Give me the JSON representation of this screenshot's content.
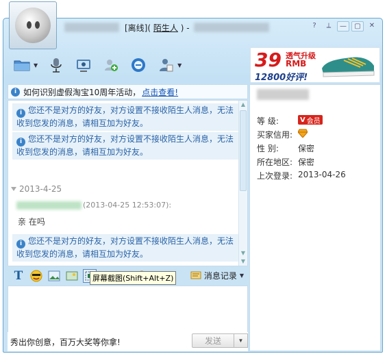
{
  "window": {
    "status": "[离线]",
    "title_prefix": "(",
    "stranger": "陌生人",
    "title_suffix": ") -"
  },
  "controls": [
    "?",
    "⟂",
    "—",
    "▢",
    "✕"
  ],
  "toolbar": {
    "icons": [
      "folder-icon",
      "microphone-icon",
      "camera-icon",
      "add-friend-icon",
      "browser-icon",
      "user-card-icon"
    ]
  },
  "ad": {
    "big_number": "39",
    "top_text": "透气升级",
    "rmb": "RMB",
    "bottom_text": "12800好评!"
  },
  "notice": {
    "text": "如何识别虚假淘宝10周年活动，",
    "link": "点击查看!"
  },
  "chat": {
    "system_msg": "您还不是对方的好友，对方设置不接收陌生人消息，无法收到您发的消息，请相互加为好友。",
    "date": "2013-4-25",
    "timestamp": "(2013-04-25 12:53:07):",
    "message": "亲  在吗"
  },
  "format_bar": {
    "history_label": "消息记录"
  },
  "tooltip": "屏幕截图(Shift+Alt+Z)",
  "bottom": {
    "promo": "秀出你创意，百万大奖等你拿!",
    "send": "发送"
  },
  "profile": {
    "rows": [
      {
        "key": "等    级:",
        "value": "会员"
      },
      {
        "key": "买家信用:",
        "value": ""
      },
      {
        "key": "性    别:",
        "value": "保密"
      },
      {
        "key": "所在地区:",
        "value": "保密"
      },
      {
        "key": "上次登录:",
        "value": "2013-04-26"
      }
    ],
    "vip_mark": "V"
  }
}
